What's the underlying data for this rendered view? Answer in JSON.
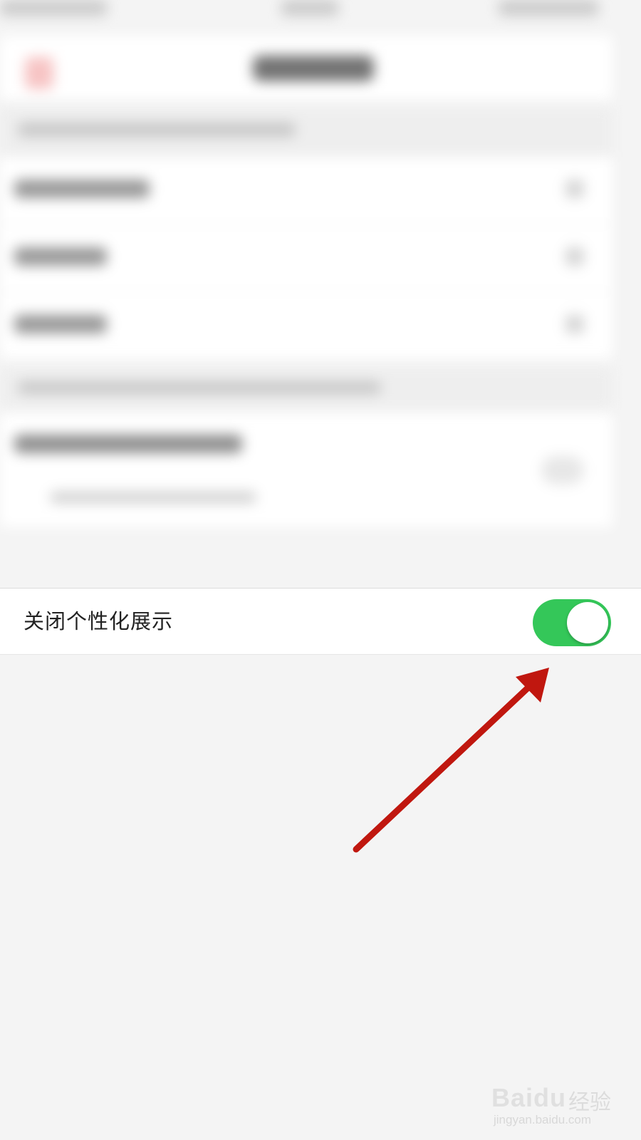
{
  "settings_row": {
    "label": "关闭个性化展示",
    "toggle_on": true,
    "toggle_color": "#34c759"
  },
  "annotation": {
    "arrow_color": "#c0170f"
  },
  "watermark": {
    "logo": "Baidu",
    "logo_cn": "经验",
    "url": "jingyan.baidu.com"
  }
}
